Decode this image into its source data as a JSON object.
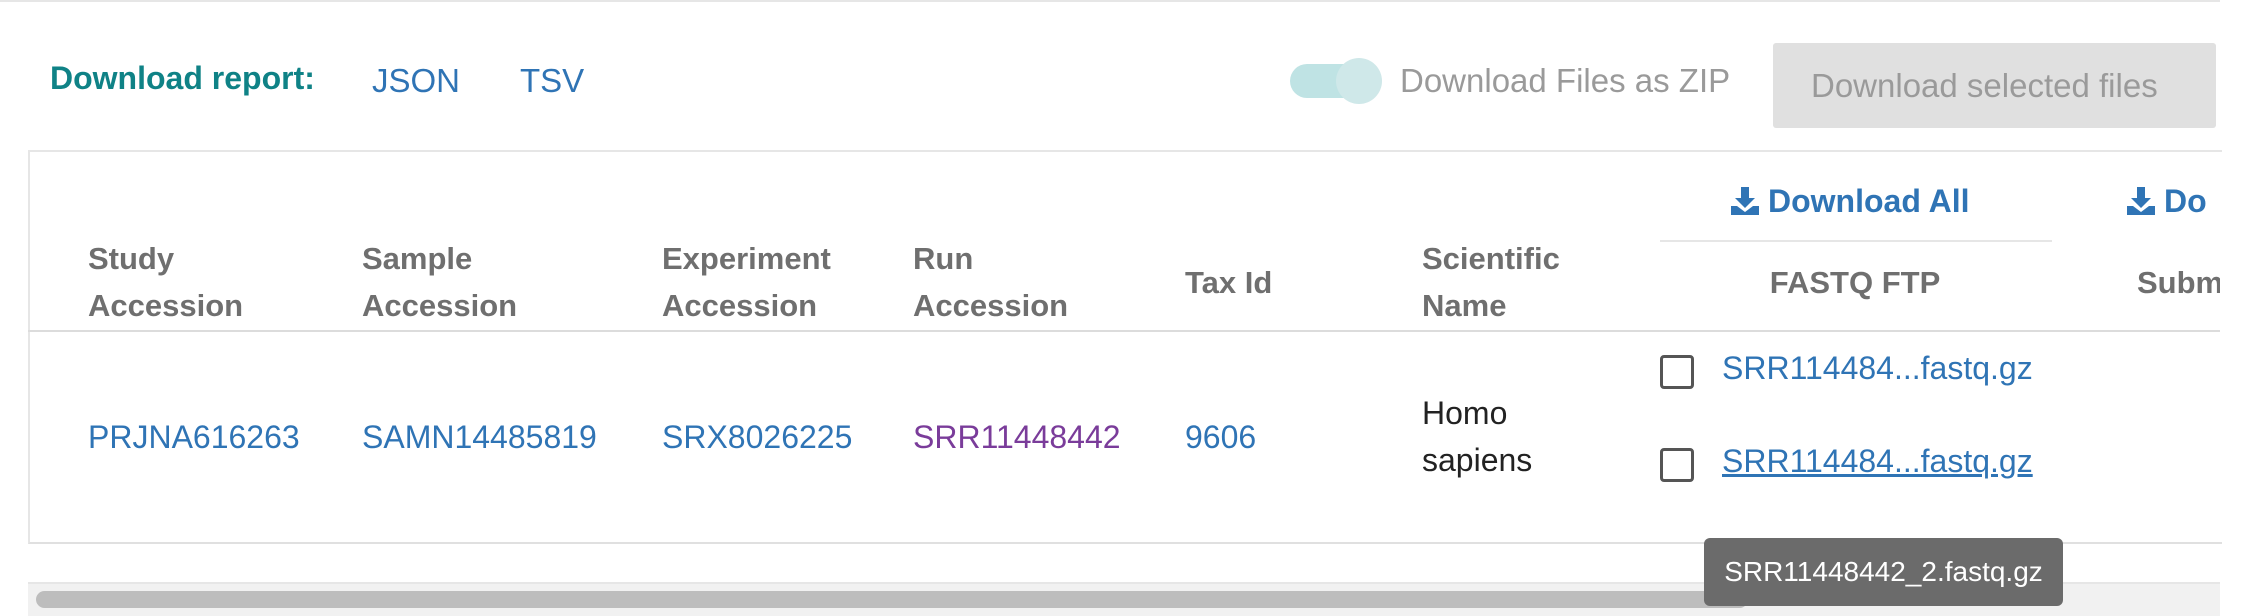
{
  "toolbar": {
    "download_report_label": "Download report:",
    "formats": [
      "JSON",
      "TSV"
    ],
    "zip_toggle_label": "Download Files as ZIP",
    "zip_toggle_on": true,
    "download_selected_label": "Download selected files"
  },
  "table": {
    "columns": {
      "study": "Study Accession",
      "sample": "Sample Accession",
      "experiment": "Experiment Accession",
      "run": "Run Accession",
      "tax": "Tax Id",
      "scientific": "Scientific Name",
      "fastq": "FASTQ FTP",
      "submitted": "Subm"
    },
    "download_all_label": "Download All",
    "download_all_partial_label": "Do",
    "rows": [
      {
        "study": "PRJNA616263",
        "sample": "SAMN14485819",
        "experiment": "SRX8026225",
        "run": "SRR11448442",
        "tax": "9606",
        "scientific": "Homo sapiens",
        "fastq_files": [
          "SRR114484...fastq.gz",
          "SRR114484...fastq.gz"
        ]
      }
    ]
  },
  "tooltip": "SRR11448442_2.fastq.gz",
  "colors": {
    "accent_teal": "#0f8286",
    "link_blue": "#2f74b5",
    "visited_purple": "#7a3c9a",
    "toggle_track": "#bfe3e4",
    "disabled_button": "#e0e0e0"
  },
  "icons": {
    "download": "download-tray-icon"
  }
}
